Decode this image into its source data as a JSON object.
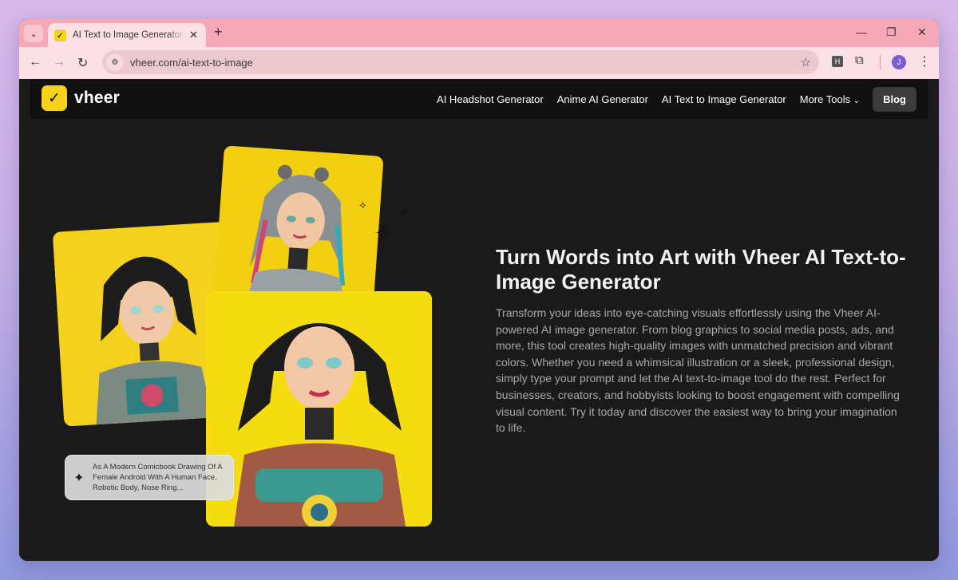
{
  "browser": {
    "tab": {
      "title": "AI Text to Image Generator - Cre",
      "favicon": "vheer-logo-icon"
    },
    "new_tab_label": "+",
    "url": "vheer.com/ai-text-to-image",
    "extension_badge": "H",
    "profile_initial": "J"
  },
  "site": {
    "logo_text": "vheer",
    "nav": {
      "items": [
        "AI Headshot Generator",
        "Anime AI Generator",
        "AI Text to Image Generator",
        "More Tools"
      ],
      "blog_label": "Blog"
    }
  },
  "hero": {
    "title": "Turn Words into Art with Vheer AI Text-to-Image Generator",
    "description": "Transform your ideas into eye-catching visuals effortlessly using the Vheer AI-powered AI image generator. From blog graphics to social media posts, ads, and more, this tool creates high-quality images with unmatched precision and vibrant colors. Whether you need a whimsical illustration or a sleek, professional design, simply type your prompt and let the AI text-to-image tool do the rest. Perfect for businesses, creators, and hobbyists looking to boost engagement with compelling visual content. Try it today and discover the easiest way to bring your imagination to life.",
    "prompt_preview": "As A Modern Comicbook Drawing Of A Female Android With A Human Face, Robotic Body, Nose Ring..."
  },
  "colors": {
    "accent_yellow": "#f7d21a",
    "page_bg": "#1a1a1a",
    "header_bg": "#111111",
    "tab_strip": "#f5a9b8",
    "cta_teal": "#3ab6c7"
  }
}
